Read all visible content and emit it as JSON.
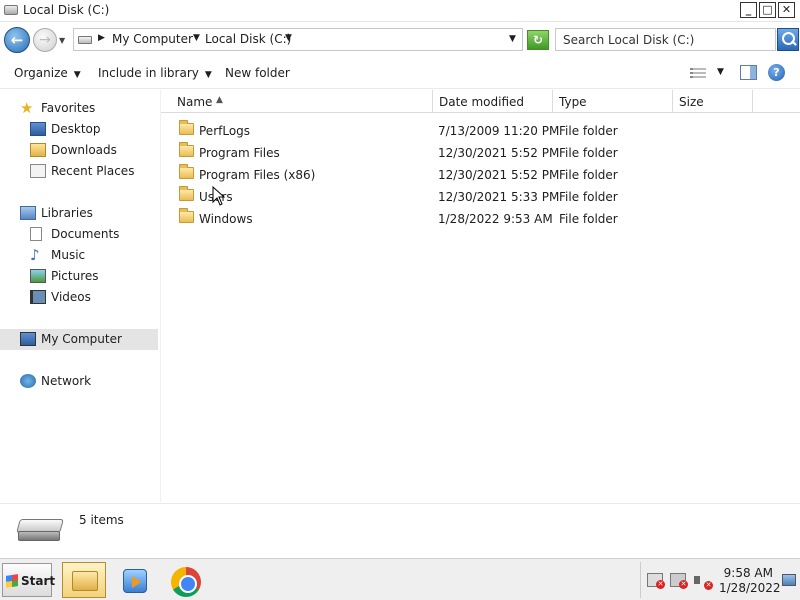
{
  "window": {
    "title": "Local Disk (C:)",
    "controls": {
      "minimize": "_",
      "maximize": "□",
      "close": "✕"
    }
  },
  "address": {
    "back_icon": "←",
    "forward_icon": "→",
    "breadcrumbs": [
      "My Computer",
      "Local Disk (C:)"
    ],
    "search_placeholder": "Search Local Disk (C:)"
  },
  "toolbar": {
    "organize": "Organize",
    "include_in_library": "Include in library",
    "new_folder": "New folder",
    "help": "?"
  },
  "navpane": {
    "favorites": {
      "label": "Favorites",
      "items": [
        "Desktop",
        "Downloads",
        "Recent Places"
      ]
    },
    "libraries": {
      "label": "Libraries",
      "items": [
        "Documents",
        "Music",
        "Pictures",
        "Videos"
      ]
    },
    "computer": "My Computer",
    "network": "Network"
  },
  "columns": {
    "name": "Name",
    "date": "Date modified",
    "type": "Type",
    "size": "Size"
  },
  "files": [
    {
      "name": "PerfLogs",
      "date": "7/13/2009 11:20 PM",
      "type": "File folder"
    },
    {
      "name": "Program Files",
      "date": "12/30/2021 5:52 PM",
      "type": "File folder"
    },
    {
      "name": "Program Files (x86)",
      "date": "12/30/2021 5:52 PM",
      "type": "File folder"
    },
    {
      "name": "Users",
      "date": "12/30/2021 5:33 PM",
      "type": "File folder"
    },
    {
      "name": "Windows",
      "date": "1/28/2022 9:53 AM",
      "type": "File folder"
    }
  ],
  "details": {
    "item_count": "5 items"
  },
  "taskbar": {
    "start": "Start",
    "time": "9:58 AM",
    "date": "1/28/2022"
  },
  "colors": {
    "accent": "#2a6fb8",
    "folder": "#e8bd55",
    "selection": "#e4e4e4"
  }
}
